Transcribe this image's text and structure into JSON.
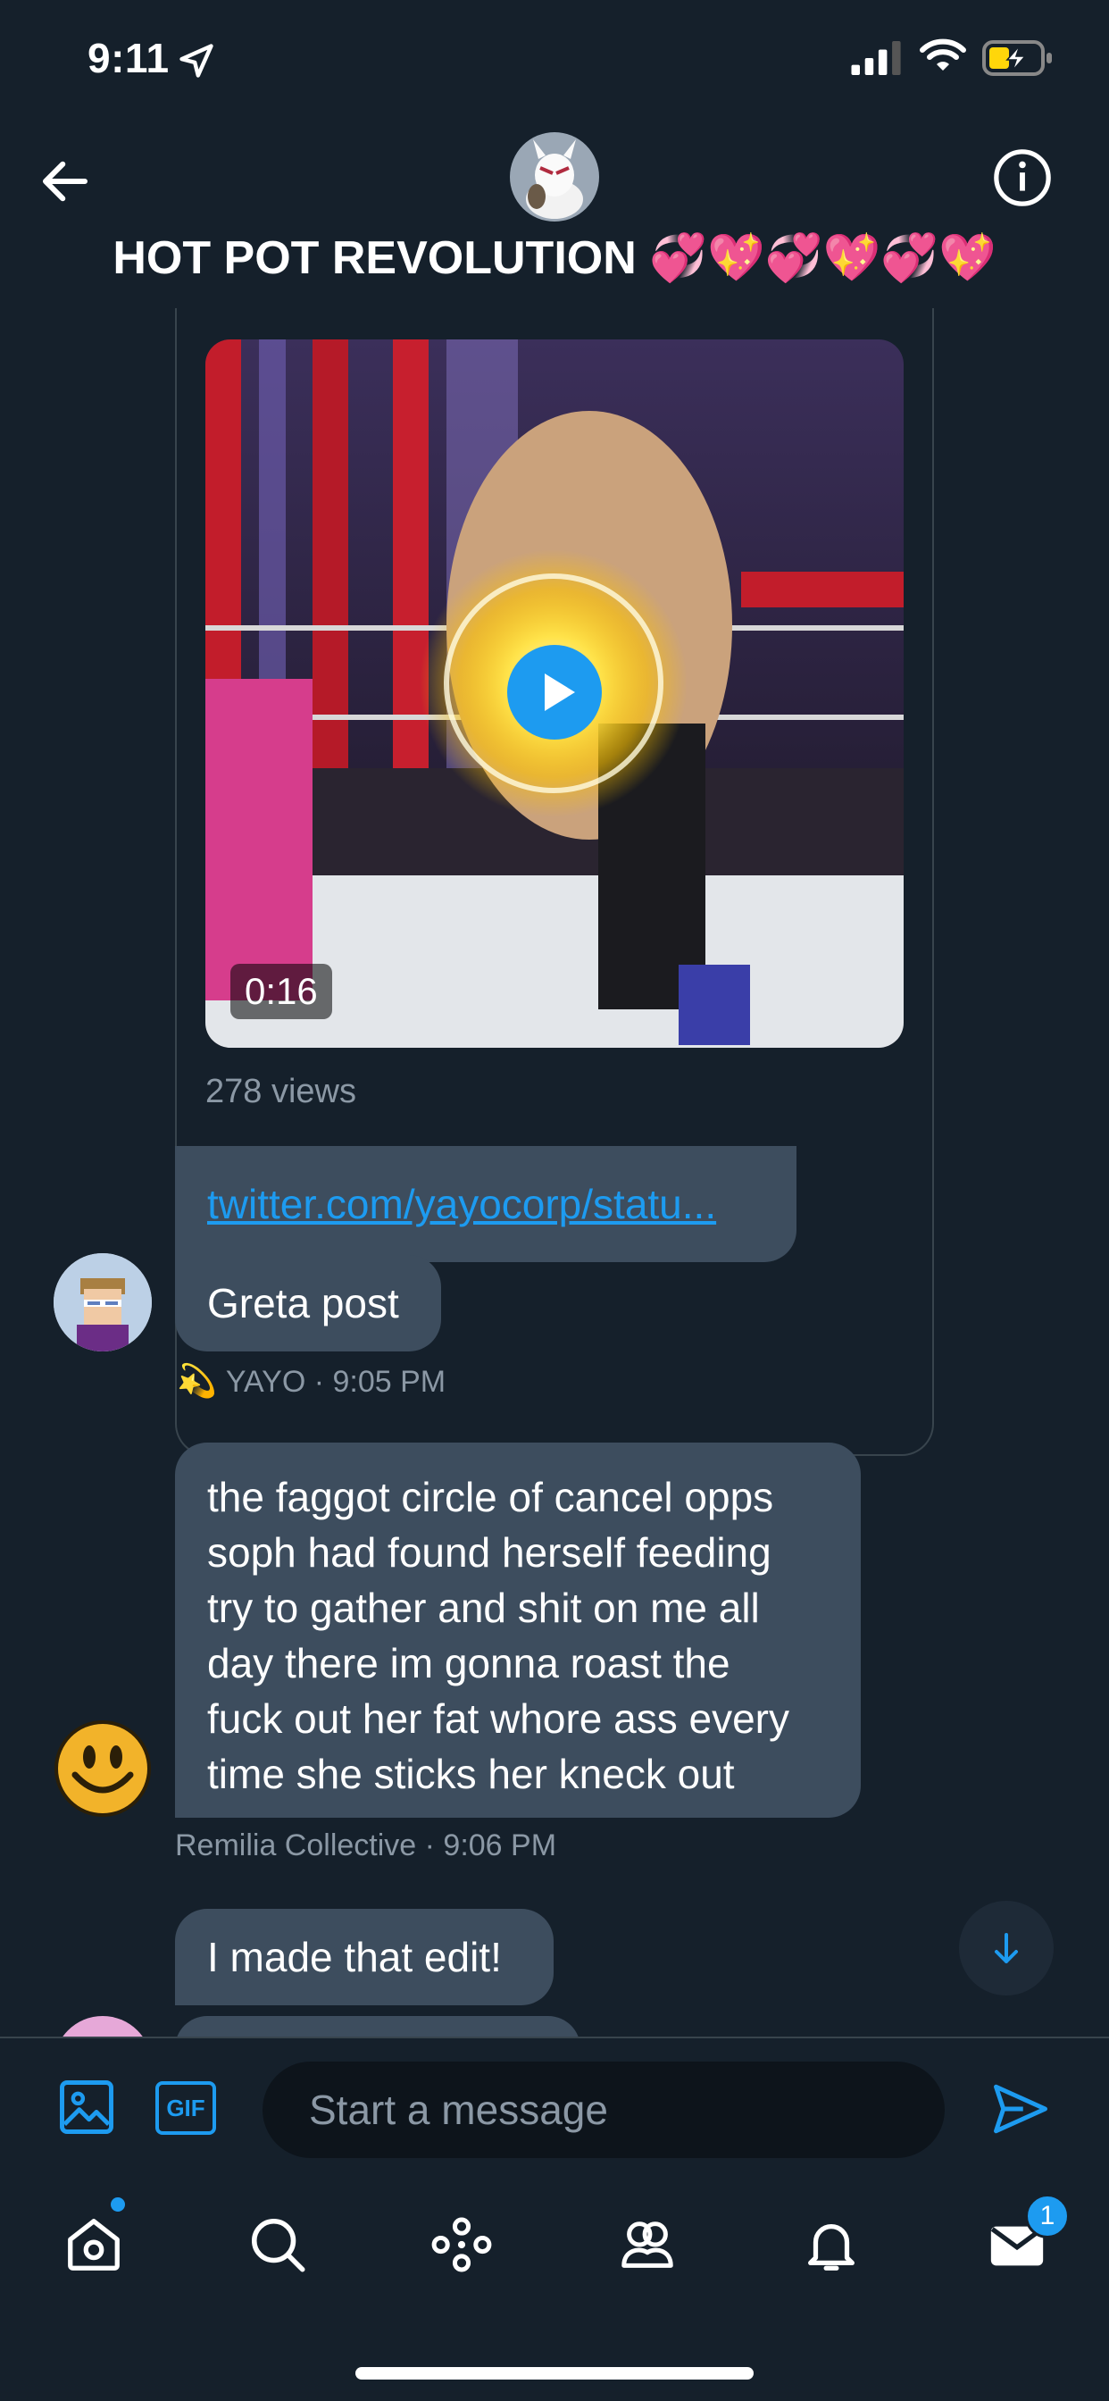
{
  "status_bar": {
    "time": "9:11"
  },
  "header": {
    "title": "HOT POT REVOLUTION 💞💖💞💖💞💖"
  },
  "tweet_card": {
    "duration": "0:16",
    "views": "278 views"
  },
  "messages": {
    "link": "twitter.com/yayocorp/statu...",
    "greta": "Greta post",
    "greta_meta_name": "YAYO",
    "greta_meta_time": "· 9:05 PM",
    "greta_emoji": "💫",
    "long_lines": [
      "the faggot circle of cancel opps",
      "soph had found herself feeding",
      "try to gather and shit on me all",
      "day there im gonna roast the",
      "fuck out her fat whore ass every",
      "time she sticks her kneck out"
    ],
    "long_meta": "Remilia Collective · 9:06 PM",
    "edit": "I made that edit!"
  },
  "composer": {
    "placeholder": "Start a message",
    "gif_label": "GIF"
  },
  "tabbar": {
    "messages_badge": "1"
  },
  "colors": {
    "background": "#15202b",
    "bubble": "#3d4d5e",
    "accent": "#1d9bf0",
    "muted": "#8b98a5"
  }
}
